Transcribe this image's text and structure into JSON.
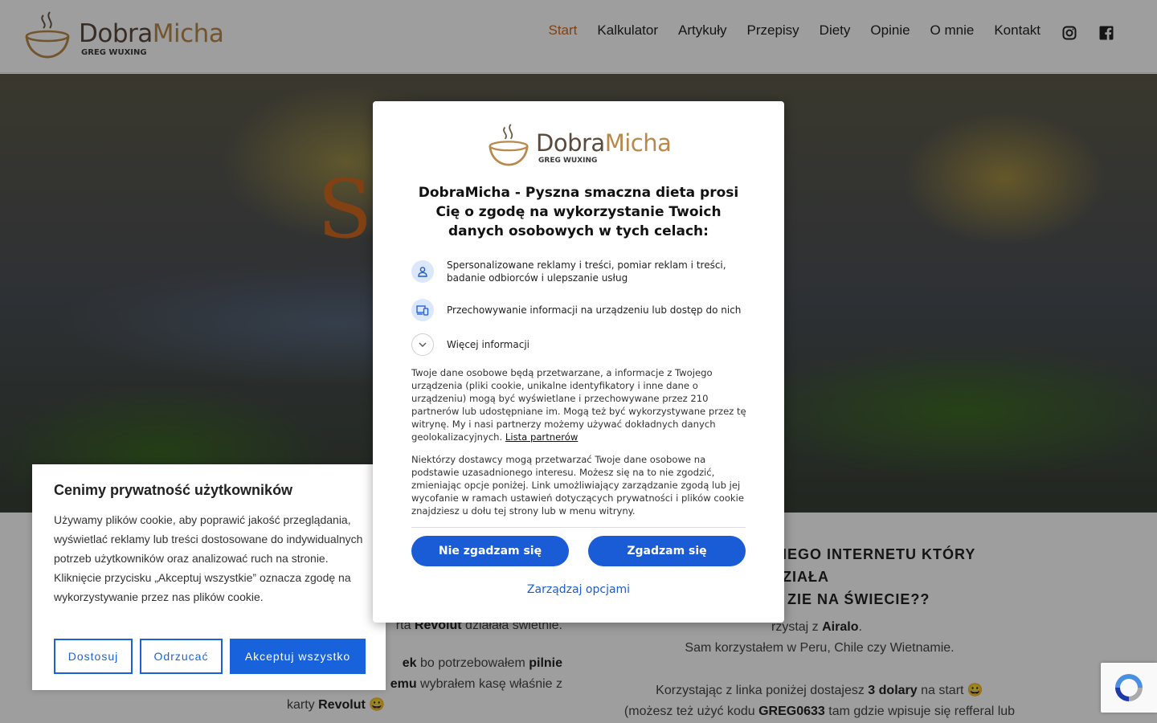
{
  "logo": {
    "brand_part1": "Dobra",
    "brand_part2": "Micha",
    "tagline": "GREG WUXING"
  },
  "nav": {
    "items": [
      {
        "label": "Start",
        "active": true
      },
      {
        "label": "Kalkulator"
      },
      {
        "label": "Artykuły"
      },
      {
        "label": "Przepisy"
      },
      {
        "label": "Diety"
      },
      {
        "label": "Opinie"
      },
      {
        "label": "O mnie"
      },
      {
        "label": "Kontakt"
      }
    ],
    "social": [
      "instagram-icon",
      "facebook-icon"
    ]
  },
  "hero": {
    "title": "Sm          ta"
  },
  "content": {
    "right_heading_1": "NIEGO INTERNETU KTÓRY DZIAŁA",
    "right_heading_2": "ZIE NA ŚWIECIE??",
    "right_line1_pre": "rzystaj z ",
    "right_line1_bold": "Airalo",
    "right_line1_post": ".",
    "right_line2": "Sam korzystałem w Peru, Chile czy Wietnamie.",
    "right_line3_pre": "Korzystając z linka poniżej dostajesz ",
    "right_line3_bold": "3 dolary",
    "right_line3_post": " na start 😀",
    "right_line4_pre": "(możesz też użyć kodu ",
    "right_line4_bold": "GREG0633",
    "right_line4_post": " tam gdzie wpisuje się refferal lub voulcher)",
    "left_line1_pre": "rta ",
    "left_line1_bold": "Revolut",
    "left_line1_post": " działała świetnie.",
    "left_line2_bold1": "ek",
    "left_line2_mid": " bo potrzebowałem ",
    "left_line2_bold2": "pilnie",
    "left_line3_bold": "emu",
    "left_line3_post": " wybrałem kasę właśnie z",
    "left_line4_pre": "karty ",
    "left_line4_bold": "Revolut",
    "left_line4_post": " 😀"
  },
  "cookie_banner": {
    "title": "Cenimy prywatność użytkowników",
    "description": "Używamy plików cookie, aby poprawić jakość przeglądania, wyświetlać reklamy lub treści dostosowane do indywidualnych potrzeb użytkowników oraz analizować ruch na stronie. Kliknięcie przycisku „Akceptuj wszystkie” oznacza zgodę na wykorzystywanie przez nas plików cookie.",
    "customize": "Dostosuj",
    "reject": "Odrzucać",
    "accept_all": "Akceptuj wszystko"
  },
  "consent_modal": {
    "heading": "DobraMicha - Pyszna smaczna dieta prosi Cię o zgodę na wykorzystanie Twoich danych osobowych w tych celach:",
    "purpose_1": "Spersonalizowane reklamy i treści, pomiar reklam i treści, badanie odbiorców i ulepszanie usług",
    "purpose_2": "Przechowywanie informacji na urządzeniu lub dostęp do nich",
    "more_info": "Więcej informacji",
    "paragraph_1": "Twoje dane osobowe będą przetwarzane, a informacje z Twojego urządzenia (pliki cookie, unikalne identyfikatory i inne dane o urządzeniu) mogą być wyświetlane i przechowywane przez 210 partnerów lub udostępniane im. Mogą też być wykorzystywane przez tę witrynę. My i nasi partnerzy możemy używać dokładnych danych geolokalizacyjnych. ",
    "partners_link": "Lista partnerów",
    "paragraph_2": "Niektórzy dostawcy mogą przetwarzać Twoje dane osobowe na podstawie uzasadnionego interesu. Możesz się na to nie zgodzić, zmieniając opcje poniżej. Link umożliwiający zarządzanie zgodą lub jej wycofanie w ramach ustawień dotyczących prywatności i plików cookie znajdziesz u dołu tej strony lub w menu witryny.",
    "do_not_consent": "Nie zgadzam się",
    "consent": "Zgadzam się",
    "manage_options": "Zarządzaj opcjami"
  },
  "colors": {
    "accent": "#d2691e",
    "brand_brown": "#5a4a3c",
    "brand_gold": "#b8894a",
    "cookie_blue": "#1863dc",
    "consent_blue": "#1a5bd6"
  }
}
